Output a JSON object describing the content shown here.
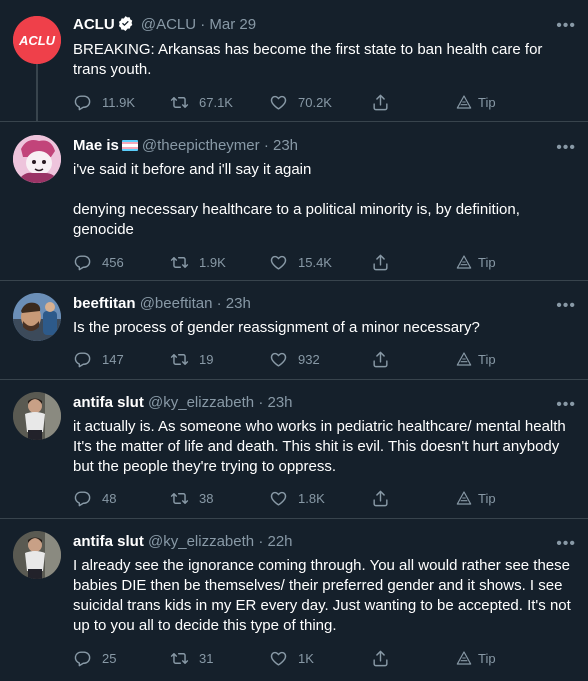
{
  "tweets": [
    {
      "name": "ACLU",
      "handle": "@ACLU",
      "time": "· Mar 29",
      "verified": true,
      "text": [
        "BREAKING: Arkansas has become the first state to ban health care for trans youth."
      ],
      "replies": "11.9K",
      "retweets": "67.1K",
      "likes": "70.2K",
      "tip": "Tip",
      "avatar_label": "ACLU"
    },
    {
      "name": "Mae is",
      "handle": "@theepictheymer",
      "time": "· 23h",
      "text": [
        "i've said it before and i'll say it again",
        "denying necessary healthcare to a political minority is, by definition, genocide"
      ],
      "replies": "456",
      "retweets": "1.9K",
      "likes": "15.4K",
      "tip": "Tip"
    },
    {
      "name": "beeftitan",
      "handle": "@beeftitan",
      "time": "· 23h",
      "text": [
        "Is the process of gender reassignment of a minor necessary?"
      ],
      "replies": "147",
      "retweets": "19",
      "likes": "932",
      "tip": "Tip"
    },
    {
      "name": "antifa slut",
      "handle": "@ky_elizzabeth",
      "time": "· 23h",
      "text": [
        "it actually is. As someone who works in pediatric healthcare/ mental health It's the matter of life and death. This shit is evil. This doesn't hurt anybody but the people they're trying to oppress."
      ],
      "replies": "48",
      "retweets": "38",
      "likes": "1.8K",
      "tip": "Tip"
    },
    {
      "name": "antifa slut",
      "handle": "@ky_elizzabeth",
      "time": "· 22h",
      "text": [
        "I already see the ignorance coming through. You all would rather see these babies DIE then be themselves/ their preferred gender and it shows. I see suicidal trans kids in my ER every day. Just wanting to be accepted. It's not up to you all to decide this type of thing."
      ],
      "replies": "25",
      "retweets": "31",
      "likes": "1K",
      "tip": "Tip"
    }
  ],
  "colors": {
    "background": "#15202b",
    "secondary_text": "#8899a6",
    "separator": "#38444d",
    "aclu_red": "#ef404a",
    "trans_blue": "#5bcefa",
    "trans_pink": "#f5a9b8"
  },
  "icons": [
    "reply-icon",
    "retweet-icon",
    "like-icon",
    "share-icon",
    "tip-icon",
    "more-icon",
    "verified-icon"
  ]
}
